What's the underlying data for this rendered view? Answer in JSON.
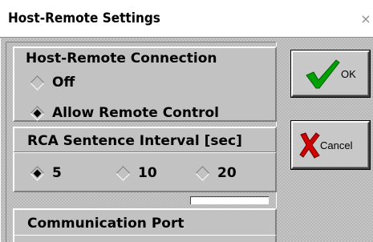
{
  "window": {
    "title": "Host-Remote Settings",
    "close_glyph": "×"
  },
  "connection": {
    "title": "Host-Remote Connection",
    "options": [
      {
        "label": "Off",
        "selected": false
      },
      {
        "label": "Allow Remote Control",
        "selected": true
      }
    ]
  },
  "interval": {
    "title": "RCA Sentence Interval [sec]",
    "options": [
      {
        "label": "5",
        "selected": true
      },
      {
        "label": "10",
        "selected": false
      },
      {
        "label": "20",
        "selected": false
      }
    ]
  },
  "port": {
    "title": "Communication Port",
    "value": ""
  },
  "buttons": {
    "ok": {
      "label": "OK",
      "icon": "green-check-icon",
      "color": "#00a000"
    },
    "cancel": {
      "label": "Cancel",
      "icon": "red-x-icon",
      "color": "#d00000"
    }
  }
}
